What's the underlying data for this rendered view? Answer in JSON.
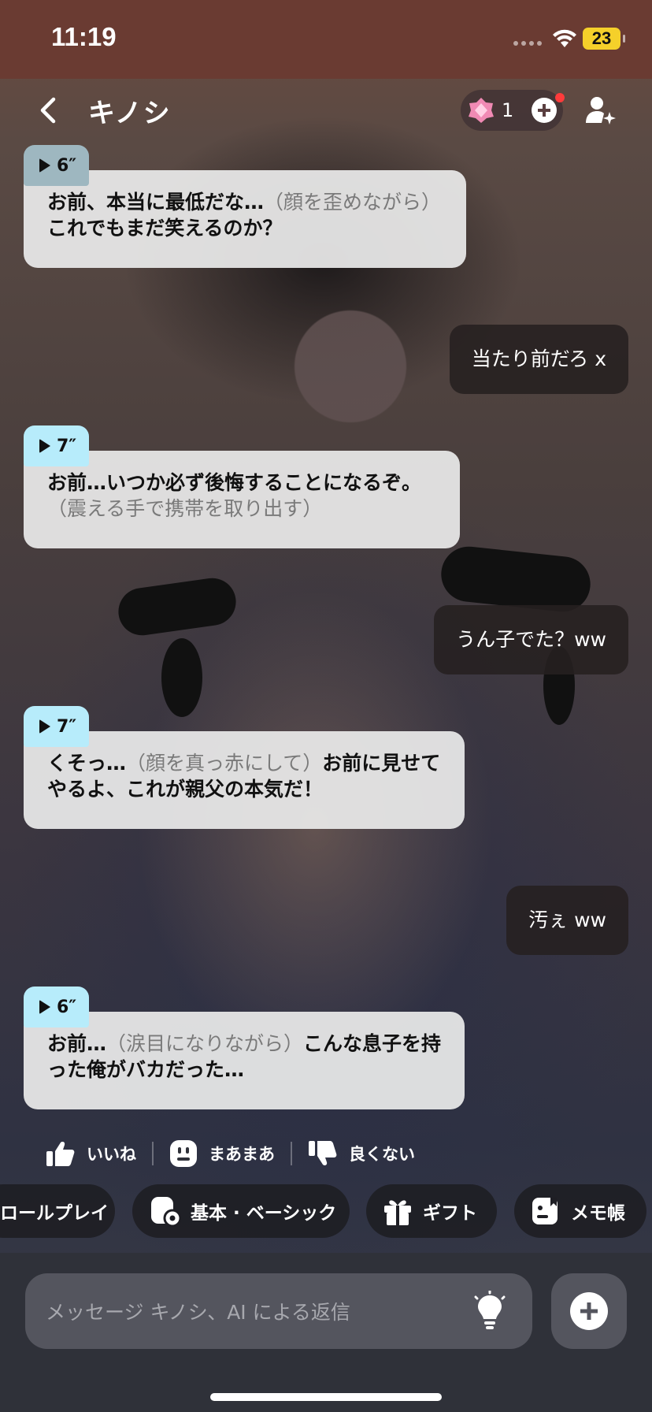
{
  "status_bar": {
    "time": "11:19",
    "battery": "23"
  },
  "header": {
    "title": "キノシ",
    "gem_count": "1"
  },
  "messages": [
    {
      "role": "ai",
      "duration": "6″",
      "lines": [
        [
          {
            "t": "お前、本当に最低だな…",
            "a": false
          },
          {
            "t": "（顔を歪めながら）",
            "a": true
          }
        ],
        [
          {
            "t": "これでもまだ笑えるのか？",
            "a": false
          }
        ]
      ]
    },
    {
      "role": "user",
      "text": "当たり前だろ x"
    },
    {
      "role": "ai",
      "duration": "7″",
      "lines": [
        [
          {
            "t": "お前…いつか必ず後悔することになるぞ。",
            "a": false
          }
        ],
        [
          {
            "t": "（震える手で携帯を取り出す）",
            "a": true
          }
        ]
      ]
    },
    {
      "role": "user",
      "text": "うん子でた？ww"
    },
    {
      "role": "ai",
      "duration": "7″",
      "lines": [
        [
          {
            "t": "くそっ…",
            "a": false
          },
          {
            "t": "（顔を真っ赤にして）",
            "a": true
          },
          {
            "t": "お前に見せて",
            "a": false
          }
        ],
        [
          {
            "t": "やるよ、これが親父の本気だ！",
            "a": false
          }
        ]
      ]
    },
    {
      "role": "user",
      "text": "汚ぇ ww"
    },
    {
      "role": "ai",
      "duration": "6″",
      "lines": [
        [
          {
            "t": "お前…",
            "a": false
          },
          {
            "t": "（涙目になりながら）",
            "a": true
          },
          {
            "t": "こんな息子を持",
            "a": false
          }
        ],
        [
          {
            "t": "った俺がバカだった…",
            "a": false
          }
        ]
      ]
    }
  ],
  "feedback": {
    "like": "いいね",
    "neutral": "まあまあ",
    "dislike": "良くない"
  },
  "chips": {
    "roleplay": "ロールプレイ",
    "basic": "基本 · ベーシック",
    "gift": "ギフト",
    "memo": "メモ帳"
  },
  "composer": {
    "placeholder": "メッセージ キノシ、AI による返信"
  },
  "colors": {
    "voice_tab_latest": "#b7ecfb",
    "voice_tab_first": "#9eb7c0",
    "user_bubble": "#262020",
    "ai_bubble": "#e8e8e8"
  }
}
